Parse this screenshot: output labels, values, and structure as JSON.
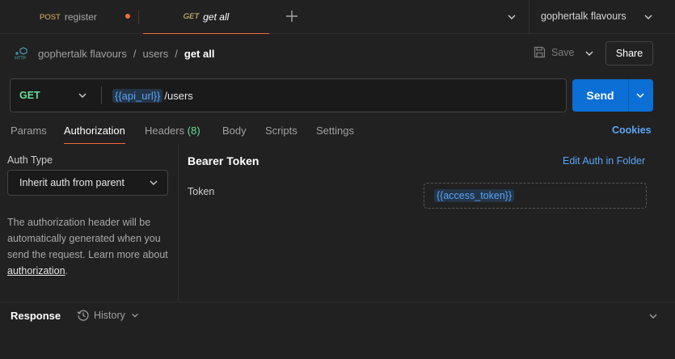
{
  "tabs": [
    {
      "method": "POST",
      "name": "register",
      "unsaved": true
    },
    {
      "method": "GET",
      "name": "get all",
      "active": true
    }
  ],
  "icons": {
    "new_tab": "plus-icon",
    "tabs_dropdown": "chevron-down-icon",
    "environment_dropdown": "chevron-down-icon",
    "request_type": "http-icon",
    "save": "floppy-disk-icon",
    "history": "history-clock-icon"
  },
  "environment": {
    "selected": "gophertalk flavours"
  },
  "breadcrumb": {
    "collection": "gophertalk flavours",
    "folder": "users",
    "current": "get all",
    "separator": "/"
  },
  "actions": {
    "save_label": "Save",
    "share_label": "Share"
  },
  "request": {
    "method": "GET",
    "url_variable": "{{api_url}}",
    "url_path": " /users",
    "send_label": "Send"
  },
  "request_tabs": [
    {
      "label": "Params"
    },
    {
      "label": "Authorization",
      "active": true
    },
    {
      "label": "Headers",
      "count": "(8)"
    },
    {
      "label": "Body"
    },
    {
      "label": "Scripts"
    },
    {
      "label": "Settings"
    }
  ],
  "cookies_label": "Cookies",
  "auth": {
    "type_label": "Auth Type",
    "type_selected": "Inherit auth from parent",
    "help_text": "The authorization header will be automatically generated when you send the request. Learn more about ",
    "help_link": "authorization",
    "help_suffix": ".",
    "bearer_title": "Bearer Token",
    "edit_folder_link": "Edit Auth in Folder",
    "token_label": "Token",
    "token_value": "{{access_token}}"
  },
  "response": {
    "label": "Response",
    "history_label": "History"
  },
  "colors": {
    "background": "#212121",
    "accent": "#f26b3a",
    "send_button": "#0b6fd6",
    "link": "#5ba4f5",
    "get_method": "#6bdd9a",
    "post_method": "#e6b563"
  }
}
